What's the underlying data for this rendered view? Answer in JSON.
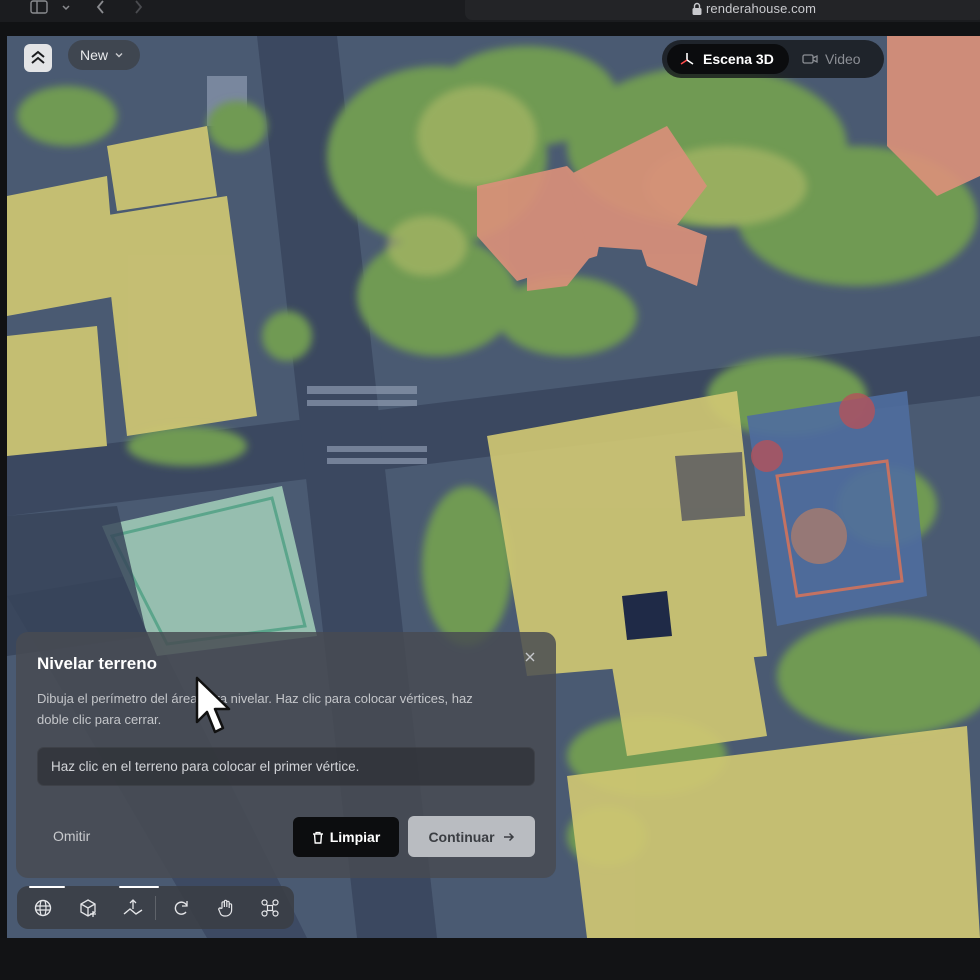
{
  "browser": {
    "url": "renderahouse.com"
  },
  "header": {
    "new_label": "New",
    "mode_3d_label": "Escena 3D",
    "mode_video_label": "Video"
  },
  "panel": {
    "title": "Nivelar terreno",
    "description": "Dibuja el perímetro del área para nivelar. Haz clic para colocar vértices, haz doble clic para cerrar.",
    "hint": "Haz clic en el terreno para colocar el primer vértice.",
    "skip_label": "Omitir",
    "clear_label": "Limpiar",
    "continue_label": "Continuar"
  },
  "toolbar": {
    "tools": [
      "globe-grid-icon",
      "cube-add-icon",
      "terrain-pin-icon",
      "rotate-icon",
      "hand-icon",
      "drone-icon"
    ]
  },
  "colors": {
    "accent": "#ffffff",
    "building_tint": "#d9cf7a",
    "school_tint": "#e39a80",
    "tree_tint": "#7fa35a"
  }
}
